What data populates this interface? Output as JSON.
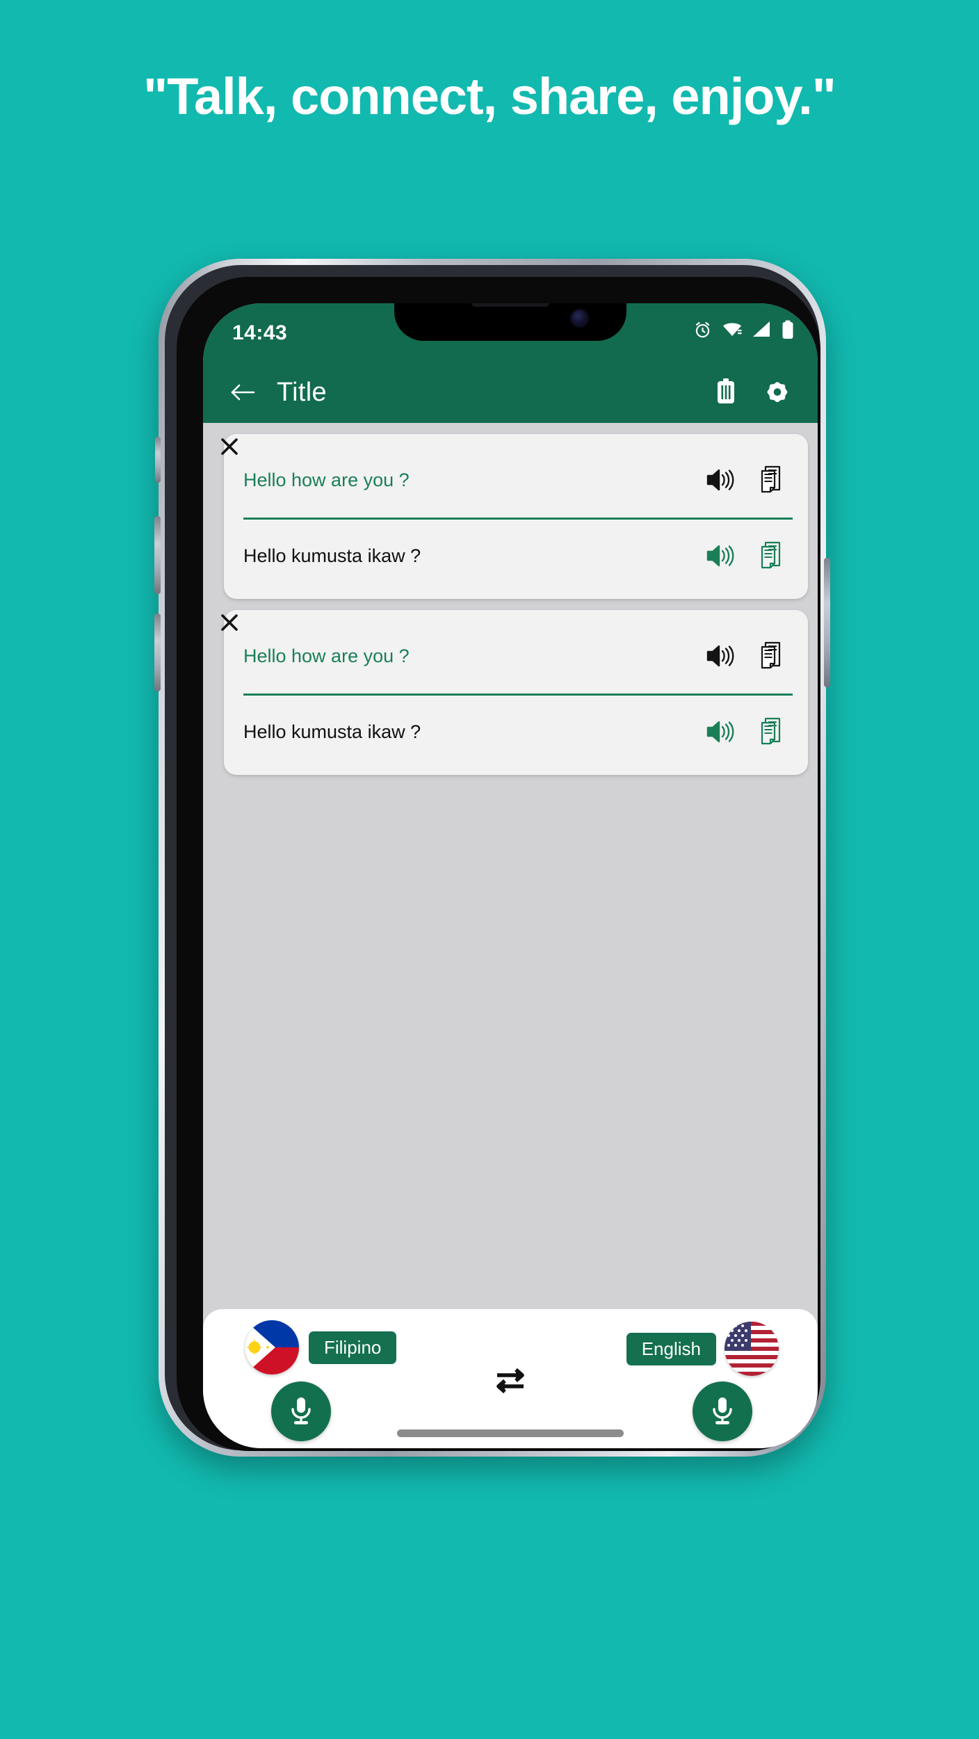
{
  "headline": "\"Talk, connect, share, enjoy.\"",
  "colors": {
    "page_background": "#12b9af",
    "app_bar": "#126b4e",
    "accent_green": "#1a7f57",
    "content_background": "#d2d1d4",
    "card_background": "#f2f2f2",
    "pill_green": "#14704f"
  },
  "status_bar": {
    "time": "14:43",
    "icons": [
      "alarm-icon",
      "wifi-icon",
      "cellular-signal-icon",
      "battery-icon"
    ]
  },
  "app_bar": {
    "back_icon": "arrow-left-icon",
    "title": "Title",
    "delete_icon": "trash-icon",
    "settings_icon": "gear-icon"
  },
  "cards": [
    {
      "close_label": "✕",
      "source_text": "Hello how are you ?",
      "target_text": "Hello kumusta ikaw ?",
      "source_speak_icon": "speaker-icon",
      "source_copy_icon": "copy-document-icon",
      "target_speak_icon": "speaker-icon",
      "target_copy_icon": "copy-document-icon"
    },
    {
      "close_label": "✕",
      "source_text": "Hello how are you ?",
      "target_text": "Hello kumusta ikaw ?",
      "source_speak_icon": "speaker-icon",
      "source_copy_icon": "copy-document-icon",
      "target_speak_icon": "speaker-icon",
      "target_copy_icon": "copy-document-icon"
    }
  ],
  "bottom_bar": {
    "left_language": "Filipino",
    "left_flag": "philippines-flag-icon",
    "left_mic_icon": "microphone-icon",
    "right_language": "English",
    "right_flag": "usa-flag-icon",
    "right_mic_icon": "microphone-icon",
    "swap_icon": "swap-arrows-icon"
  }
}
